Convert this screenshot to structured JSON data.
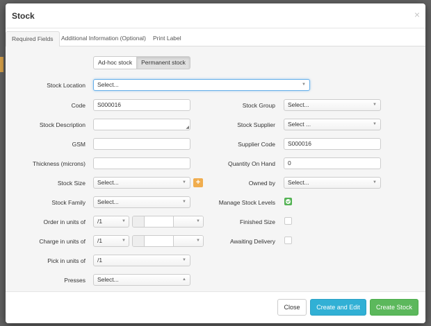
{
  "modal": {
    "title": "Stock",
    "close_glyph": "×"
  },
  "tabs": [
    {
      "label": "Required Fields",
      "active": true
    },
    {
      "label": "Additional Information (Optional)",
      "active": false
    },
    {
      "label": "Print Label",
      "active": false
    }
  ],
  "stock_type": {
    "options": [
      "Ad-hoc stock",
      "Permanent stock"
    ],
    "selected": "Permanent stock"
  },
  "fields": {
    "stock_location": {
      "label": "Stock Location",
      "value": "Select..."
    },
    "code": {
      "label": "Code",
      "value": "S000016"
    },
    "stock_description": {
      "label": "Stock Description",
      "value": ""
    },
    "gsm": {
      "label": "GSM",
      "value": ""
    },
    "thickness": {
      "label": "Thickness (microns)",
      "value": ""
    },
    "stock_size": {
      "label": "Stock Size",
      "value": "Select..."
    },
    "stock_family": {
      "label": "Stock Family",
      "value": "Select..."
    },
    "order_units": {
      "label": "Order in units of",
      "value": "/1"
    },
    "charge_units": {
      "label": "Charge in units of",
      "value": "/1"
    },
    "pick_units": {
      "label": "Pick in units of",
      "value": "/1"
    },
    "presses": {
      "label": "Presses",
      "value": "Select..."
    },
    "stock_group": {
      "label": "Stock Group",
      "value": "Select..."
    },
    "stock_supplier": {
      "label": "Stock Supplier",
      "value": "Select ..."
    },
    "supplier_code": {
      "label": "Supplier Code",
      "value": "S000016"
    },
    "quantity_on_hand": {
      "label": "Quantity On Hand",
      "value": "0"
    },
    "owned_by": {
      "label": "Owned by",
      "value": "Select..."
    },
    "manage_stock_levels": {
      "label": "Manage Stock Levels",
      "checked": true
    },
    "finished_size": {
      "label": "Finished Size",
      "checked": false
    },
    "awaiting_delivery": {
      "label": "Awaiting Delivery",
      "checked": false
    }
  },
  "icons": {
    "caret_down": "▼",
    "caret_up": "▲",
    "plus": "+",
    "resize": "◢"
  },
  "footer": {
    "close_label": "Close",
    "create_edit_label": "Create and Edit",
    "create_label": "Create Stock"
  },
  "colors": {
    "create_edit_bg": "#31b0d5",
    "create_bg": "#5cb85c",
    "plus_bg": "#f0ad4e",
    "checkbox_on": "#5cb85c"
  }
}
